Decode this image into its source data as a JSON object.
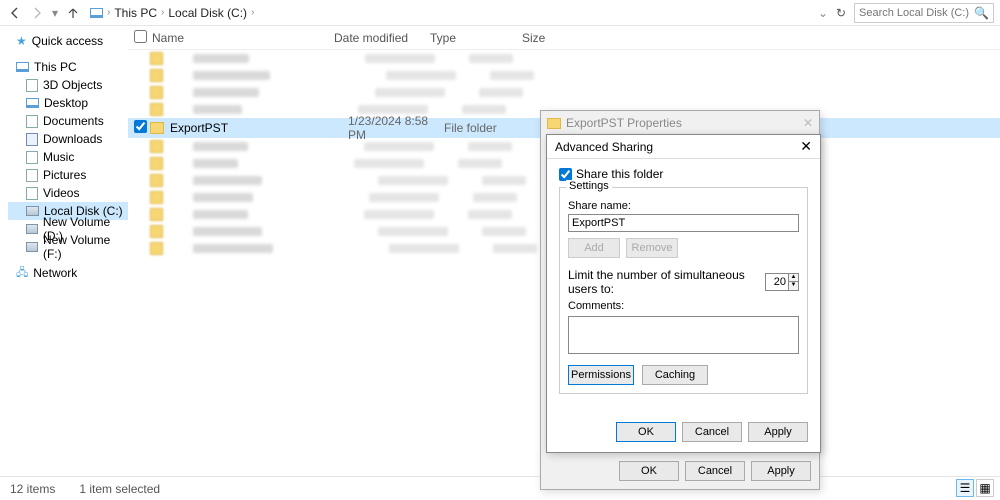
{
  "breadcrumb": {
    "seg1": "This PC",
    "seg2": "Local Disk (C:)"
  },
  "search": {
    "placeholder": "Search Local Disk (C:)"
  },
  "sidebar": {
    "quick": "Quick access",
    "thispc": "This PC",
    "items": [
      "3D Objects",
      "Desktop",
      "Documents",
      "Downloads",
      "Music",
      "Pictures",
      "Videos",
      "Local Disk (C:)",
      "New Volume (D:)",
      "New Volume (F:)"
    ],
    "network": "Network"
  },
  "cols": {
    "name": "Name",
    "date": "Date modified",
    "type": "Type",
    "size": "Size"
  },
  "row": {
    "name": "ExportPST",
    "date": "1/23/2024 8:58 PM",
    "type": "File folder"
  },
  "status": {
    "total": "12 items",
    "selected": "1 item selected"
  },
  "propwin": {
    "title": "ExportPST Properties",
    "ok": "OK",
    "cancel": "Cancel",
    "apply": "Apply"
  },
  "adv": {
    "title": "Advanced Sharing",
    "share_chk": "Share this folder",
    "settings_legend": "Settings",
    "share_name_lbl": "Share name:",
    "share_name_val": "ExportPST",
    "add": "Add",
    "remove": "Remove",
    "limit_lbl": "Limit the number of simultaneous users to:",
    "limit_val": "20",
    "comments_lbl": "Comments:",
    "permissions": "Permissions",
    "caching": "Caching",
    "ok": "OK",
    "cancel": "Cancel",
    "apply": "Apply"
  }
}
